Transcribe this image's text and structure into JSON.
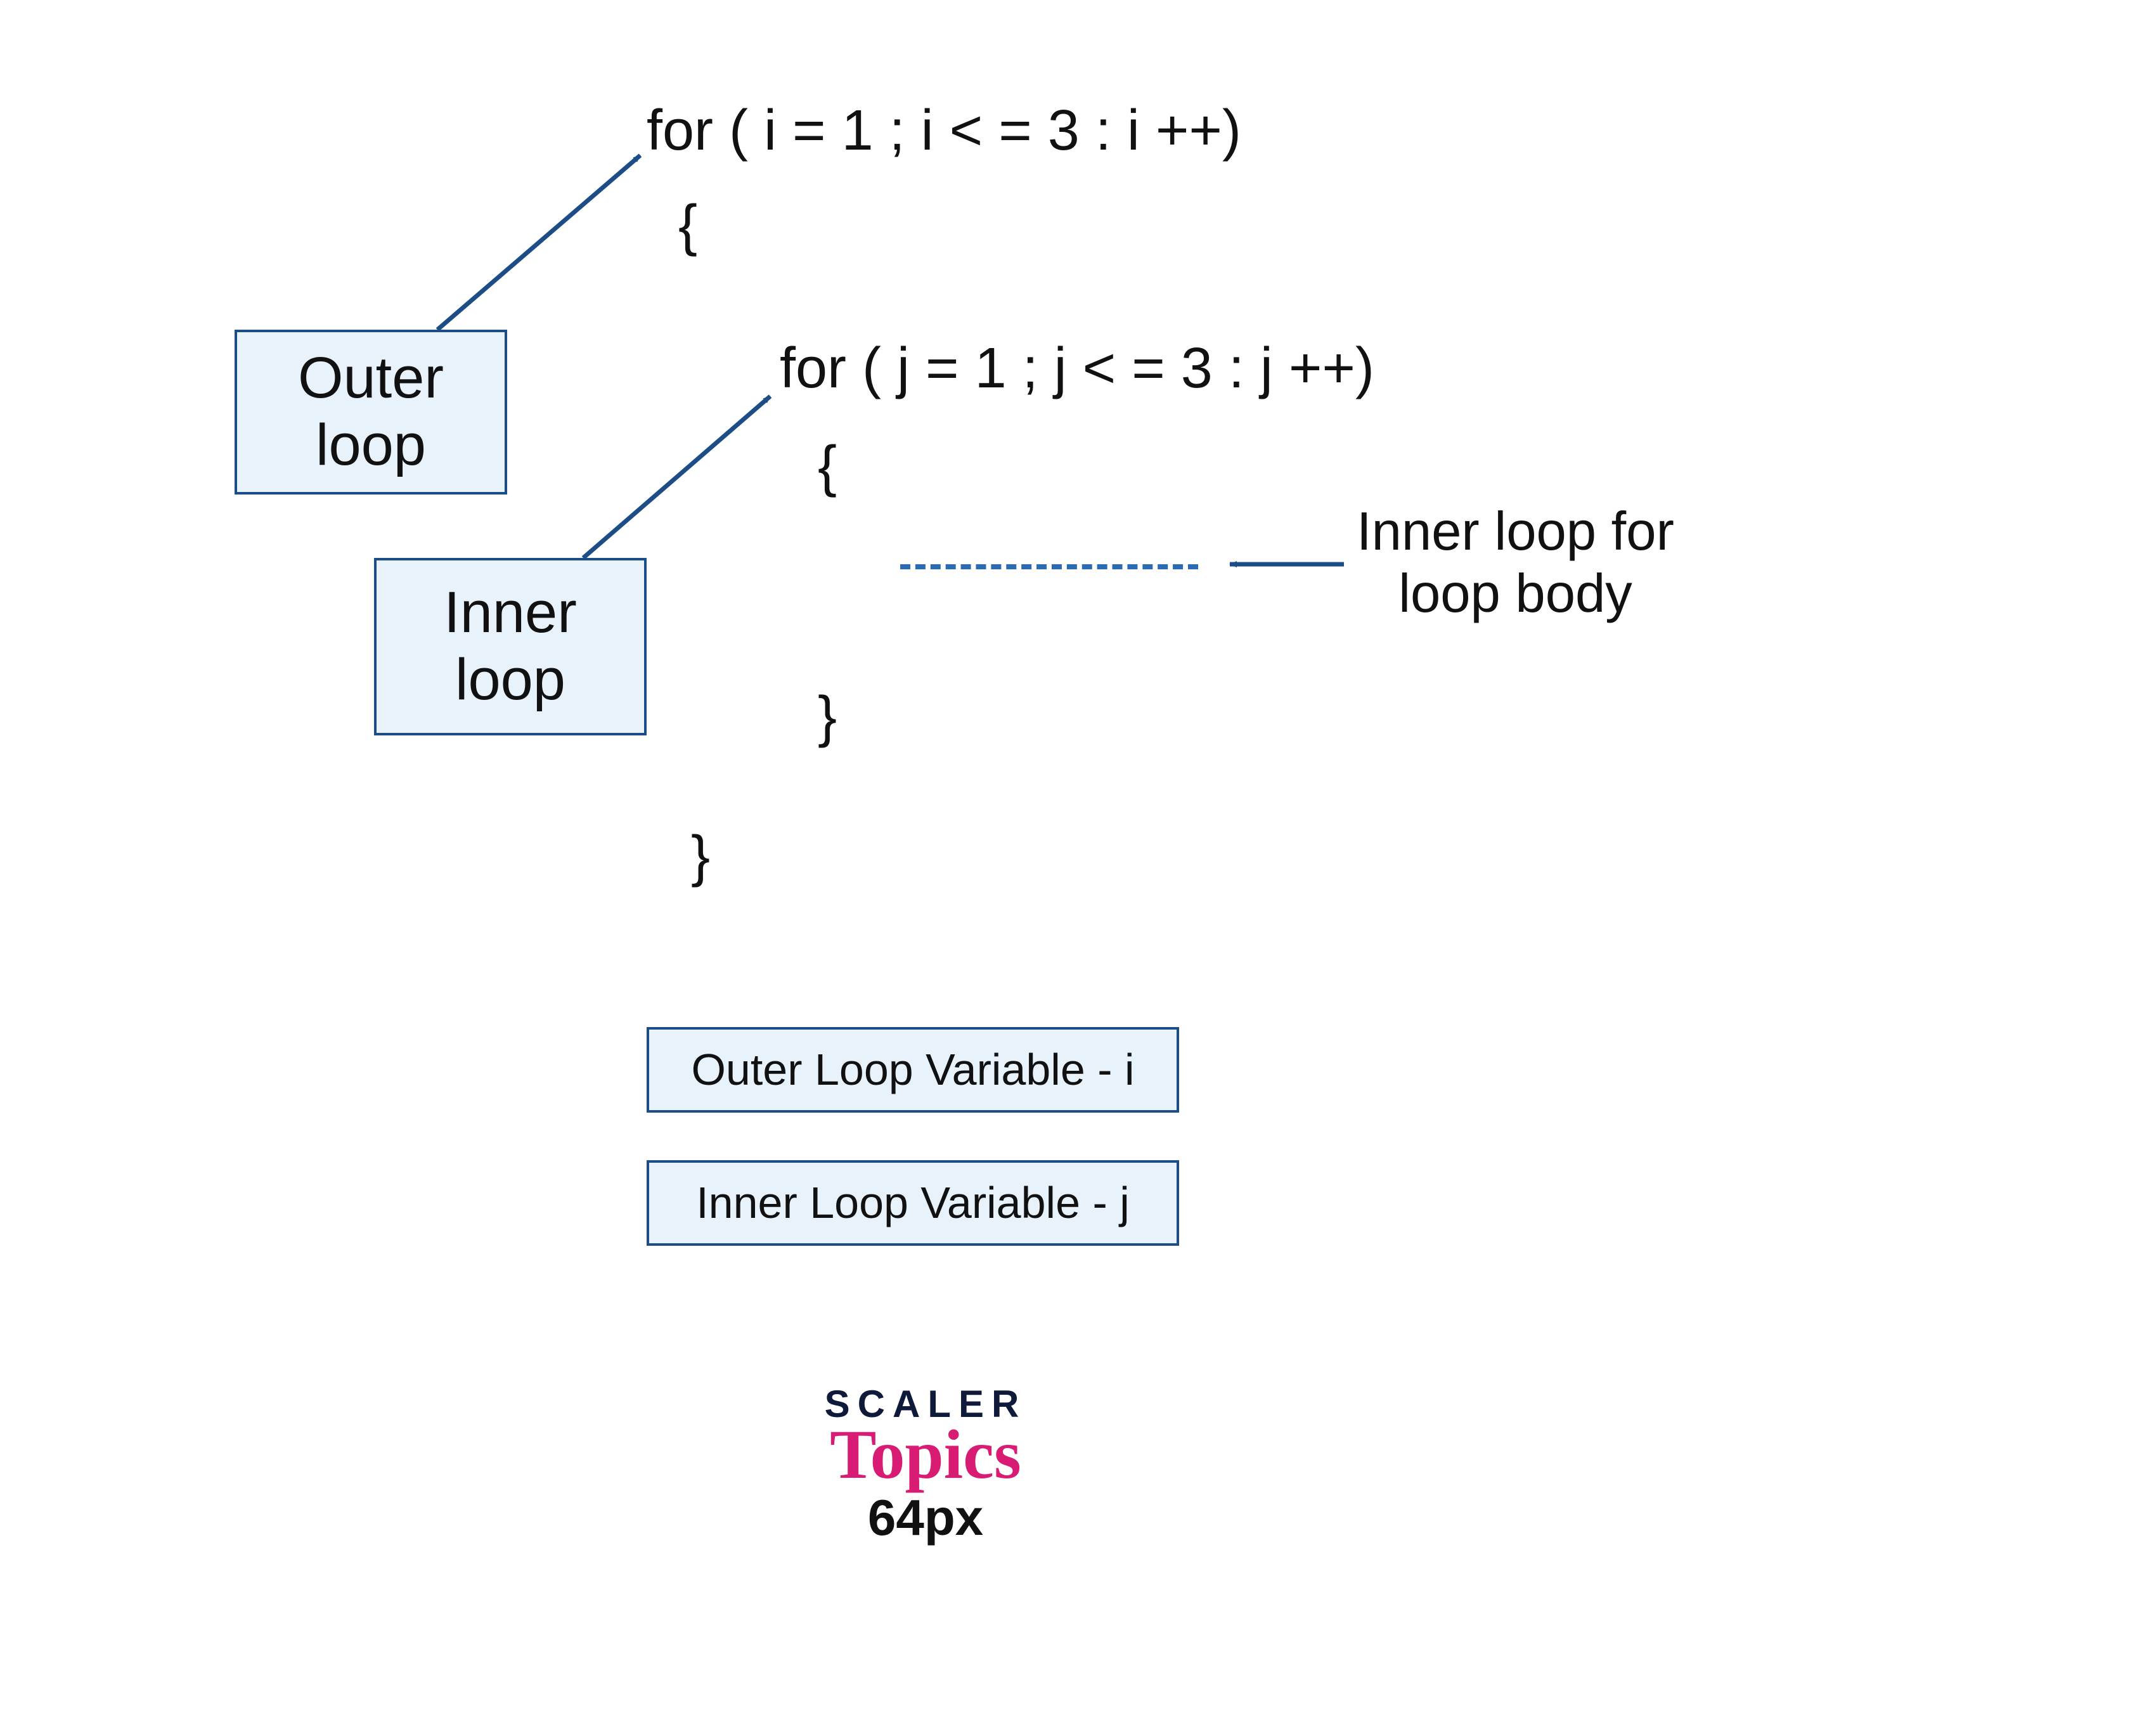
{
  "code": {
    "outer_for": "for ( i = 1 ; i < = 3 : i ++)",
    "outer_open": "{",
    "inner_for": "for ( j = 1 ; j < = 3 : j ++)",
    "inner_open": "{",
    "inner_close": "}",
    "outer_close": "}"
  },
  "labels": {
    "outer_loop_line1": "Outer",
    "outer_loop_line2": "loop",
    "inner_loop_line1": "Inner",
    "inner_loop_line2": "loop",
    "body_line1": "Inner loop for",
    "body_line2": "loop body",
    "var_outer": "Outer Loop Variable - i",
    "var_inner": "Inner Loop Variable - j"
  },
  "brand": {
    "top": "SCALER",
    "mid": "Topics",
    "bot": "64px"
  },
  "colors": {
    "box_bg": "#e8f2fb",
    "box_border": "#1d4d86",
    "arrow": "#1d4d86",
    "dash": "#2b6bb2",
    "logo_dark": "#0f1a3a",
    "logo_pink": "#d81b73"
  }
}
